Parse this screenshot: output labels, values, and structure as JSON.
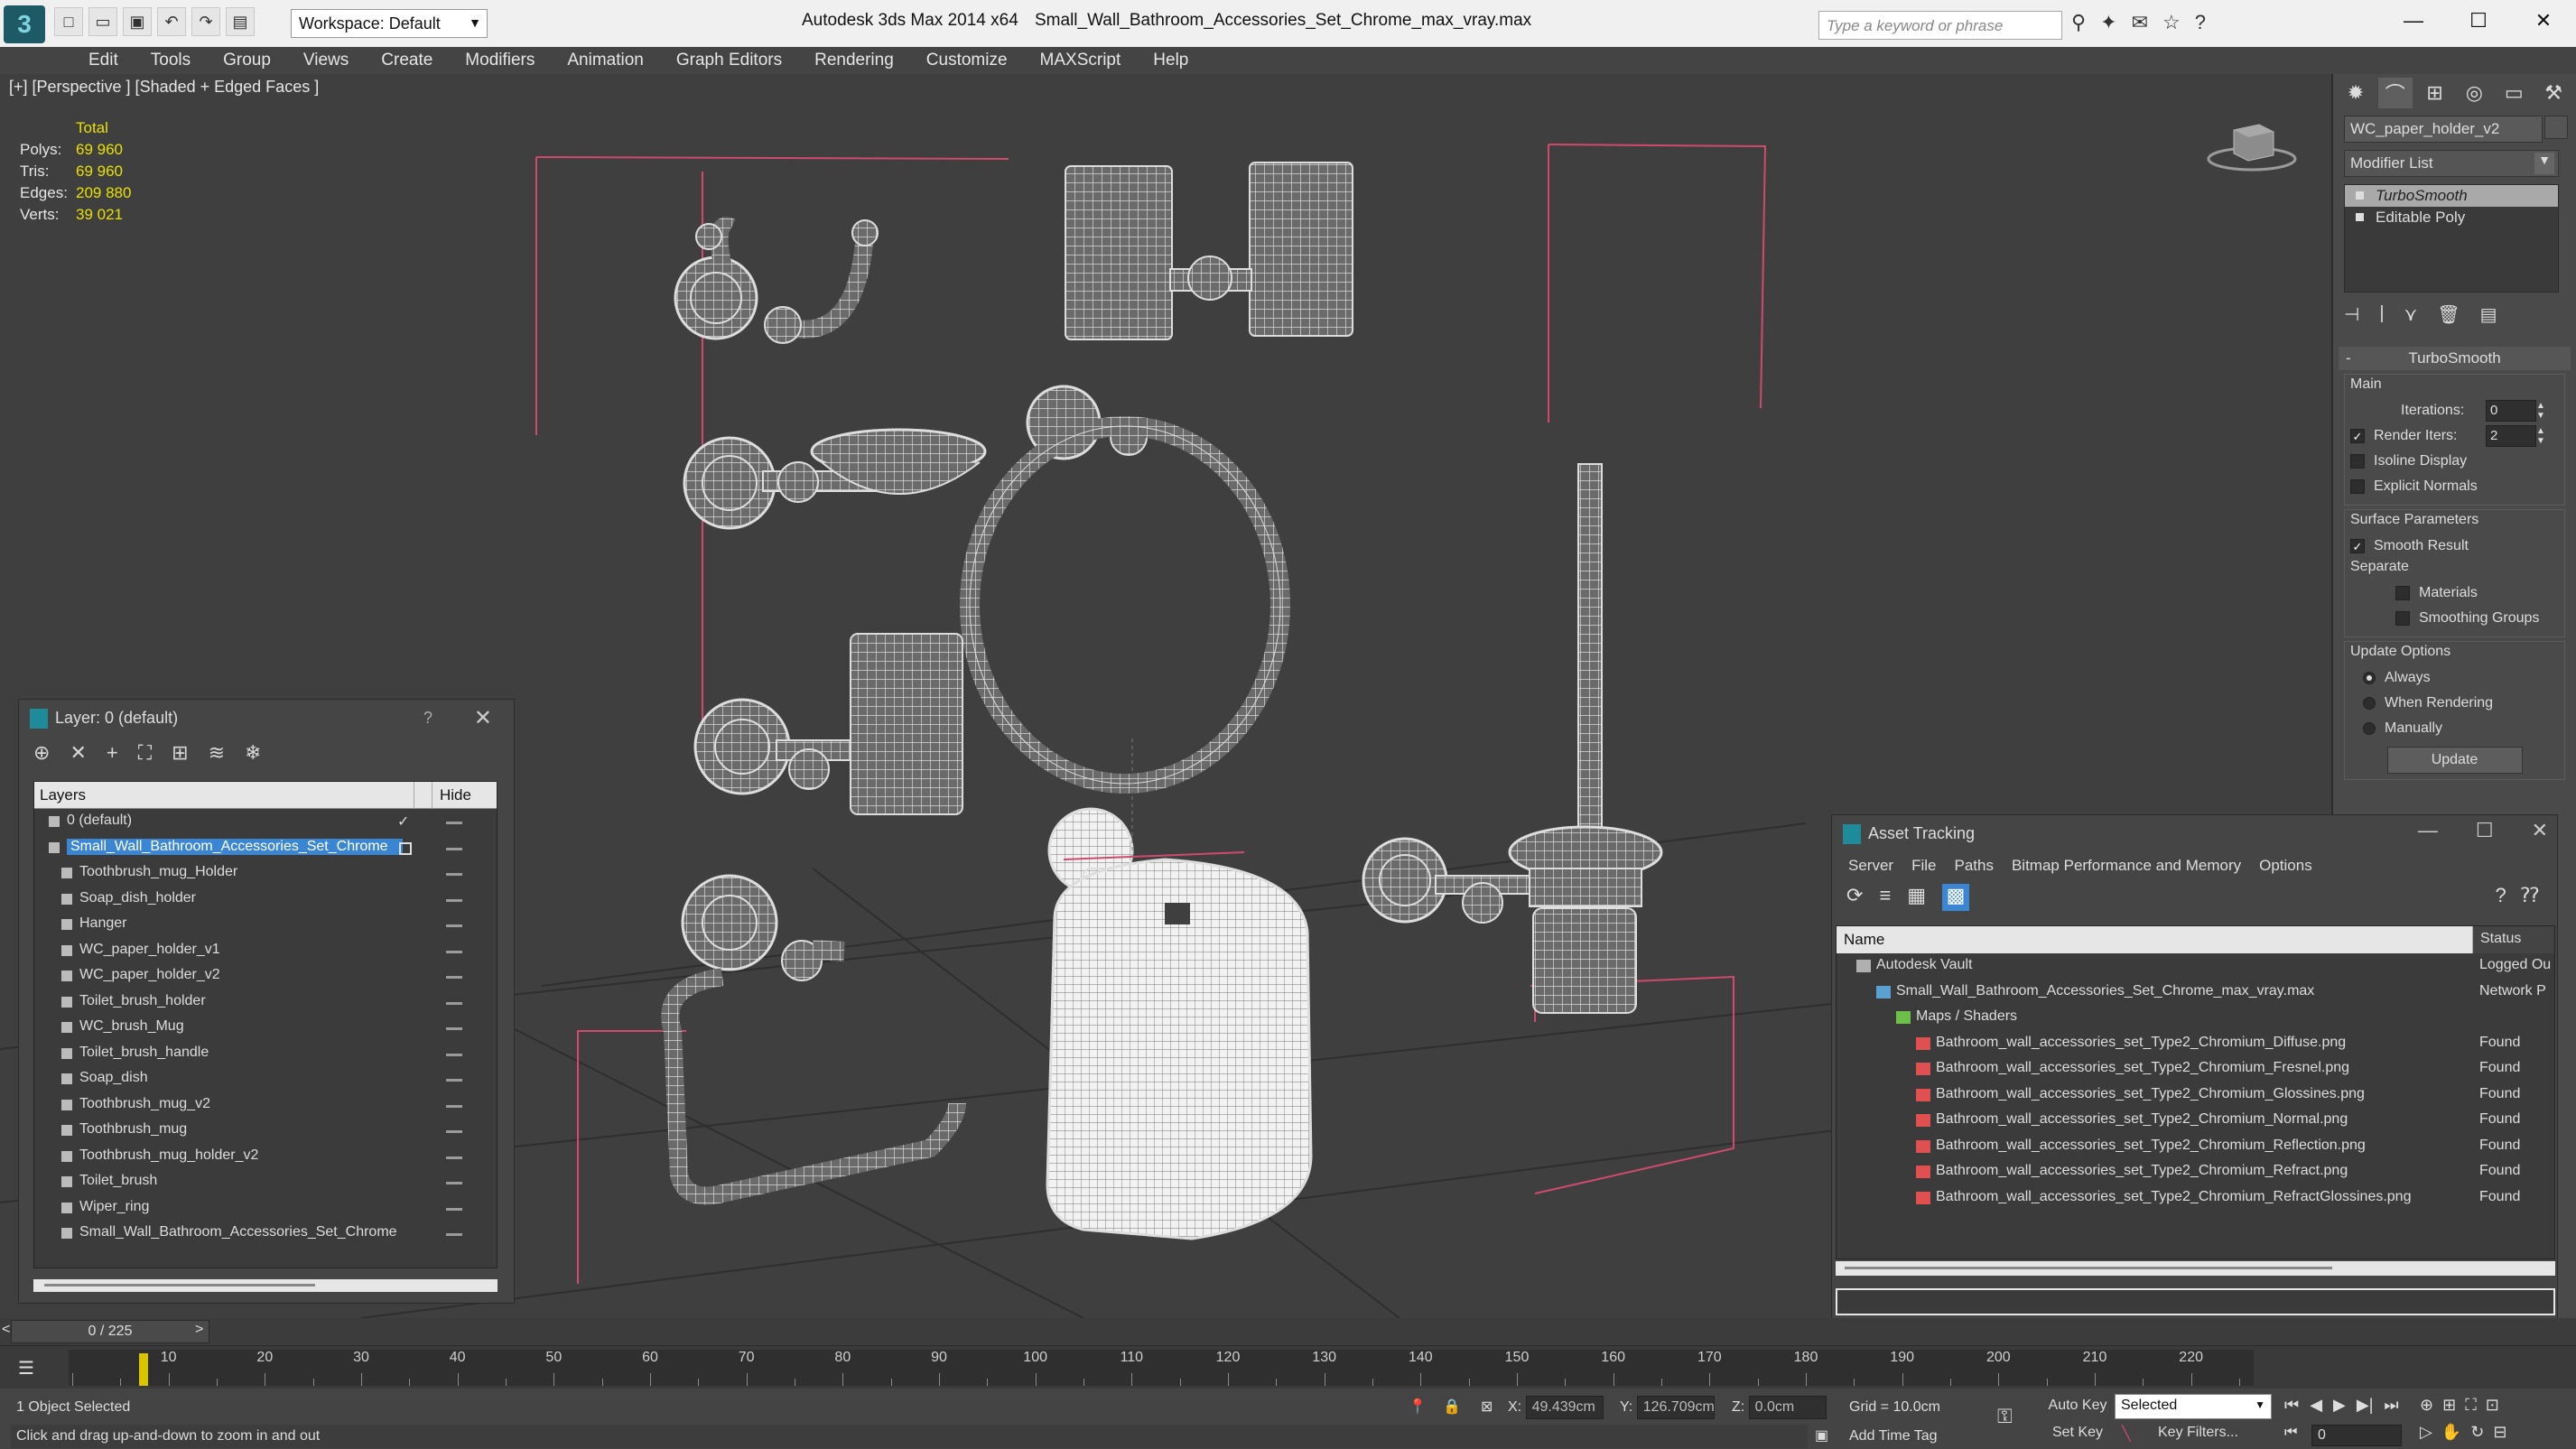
{
  "title_bar": {
    "app_title": "Autodesk 3ds Max  2014 x64",
    "file_name": "Small_Wall_Bathroom_Accessories_Set_Chrome_max_vray.max",
    "workspace": "Workspace: Default",
    "search_placeholder": "Type a keyword or phrase"
  },
  "menu": [
    "Edit",
    "Tools",
    "Group",
    "Views",
    "Create",
    "Modifiers",
    "Animation",
    "Graph Editors",
    "Rendering",
    "Customize",
    "MAXScript",
    "Help"
  ],
  "viewport": {
    "label": "[+] [Perspective ] [Shaded + Edged Faces ]",
    "stats": {
      "total_label": "Total",
      "rows": [
        {
          "label": "Polys:",
          "value": "69 960"
        },
        {
          "label": "Tris:",
          "value": "69 960"
        },
        {
          "label": "Edges:",
          "value": "209 880"
        },
        {
          "label": "Verts:",
          "value": "39 021"
        }
      ]
    }
  },
  "command_panel": {
    "object_name": "WC_paper_holder_v2",
    "modifier_list": "Modifier List",
    "stack": [
      "TurboSmooth",
      "Editable Poly"
    ],
    "rollout": "TurboSmooth",
    "main_label": "Main",
    "iterations_label": "Iterations:",
    "iterations_value": "0",
    "render_iters_label": "Render Iters:",
    "render_iters_value": "2",
    "isoline": "Isoline Display",
    "explicit_normals": "Explicit Normals",
    "surface_params": "Surface Parameters",
    "smooth_result": "Smooth Result",
    "separate": "Separate",
    "materials": "Materials",
    "smoothing_groups": "Smoothing Groups",
    "update_options": "Update Options",
    "always": "Always",
    "when_rendering": "When Rendering",
    "manually": "Manually",
    "update_btn": "Update"
  },
  "layer_dialog": {
    "title": "Layer: 0 (default)",
    "help": "?",
    "col_layers": "Layers",
    "col_hide": "Hide",
    "rows": [
      {
        "name": "0 (default)",
        "level": 0
      },
      {
        "name": "Small_Wall_Bathroom_Accessories_Set_Chrome",
        "level": 0
      },
      {
        "name": "Toothbrush_mug_Holder",
        "level": 1
      },
      {
        "name": "Soap_dish_holder",
        "level": 1
      },
      {
        "name": "Hanger",
        "level": 1
      },
      {
        "name": "WC_paper_holder_v1",
        "level": 1
      },
      {
        "name": "WC_paper_holder_v2",
        "level": 1
      },
      {
        "name": "Toilet_brush_holder",
        "level": 1
      },
      {
        "name": "WC_brush_Mug",
        "level": 1
      },
      {
        "name": "Toilet_brush_handle",
        "level": 1
      },
      {
        "name": "Soap_dish",
        "level": 1
      },
      {
        "name": "Toothbrush_mug_v2",
        "level": 1
      },
      {
        "name": "Toothbrush_mug",
        "level": 1
      },
      {
        "name": "Toothbrush_mug_holder_v2",
        "level": 1
      },
      {
        "name": "Toilet_brush",
        "level": 1
      },
      {
        "name": "Wiper_ring",
        "level": 1
      },
      {
        "name": "Small_Wall_Bathroom_Accessories_Set_Chrome",
        "level": 1
      }
    ]
  },
  "asset_dialog": {
    "title": "Asset Tracking",
    "menu": [
      "Server",
      "File",
      "Paths",
      "Bitmap Performance and Memory",
      "Options"
    ],
    "col_name": "Name",
    "col_status": "Status",
    "rows": [
      {
        "name": "Autodesk Vault",
        "status": "Logged Ou",
        "level": 0,
        "icon": "vault"
      },
      {
        "name": "Small_Wall_Bathroom_Accessories_Set_Chrome_max_vray.max",
        "status": "Network P",
        "level": 1,
        "icon": "max"
      },
      {
        "name": "Maps / Shaders",
        "status": "",
        "level": 2,
        "icon": "maps"
      },
      {
        "name": "Bathroom_wall_accessories_set_Type2_Chromium_Diffuse.png",
        "status": "Found",
        "level": 3,
        "icon": "png"
      },
      {
        "name": "Bathroom_wall_accessories_set_Type2_Chromium_Fresnel.png",
        "status": "Found",
        "level": 3,
        "icon": "png"
      },
      {
        "name": "Bathroom_wall_accessories_set_Type2_Chromium_Glossines.png",
        "status": "Found",
        "level": 3,
        "icon": "png"
      },
      {
        "name": "Bathroom_wall_accessories_set_Type2_Chromium_Normal.png",
        "status": "Found",
        "level": 3,
        "icon": "png"
      },
      {
        "name": "Bathroom_wall_accessories_set_Type2_Chromium_Reflection.png",
        "status": "Found",
        "level": 3,
        "icon": "png"
      },
      {
        "name": "Bathroom_wall_accessories_set_Type2_Chromium_Refract.png",
        "status": "Found",
        "level": 3,
        "icon": "png"
      },
      {
        "name": "Bathroom_wall_accessories_set_Type2_Chromium_RefractGlossines.png",
        "status": "Found",
        "level": 3,
        "icon": "png"
      }
    ]
  },
  "timeline": {
    "frame_display": "0 / 225",
    "ticks": [
      "10",
      "20",
      "30",
      "40",
      "50",
      "60",
      "70",
      "80",
      "90",
      "100",
      "110",
      "120",
      "130",
      "140",
      "150",
      "160",
      "170",
      "180",
      "190",
      "200",
      "210",
      "220"
    ]
  },
  "status_bar": {
    "selection": "1 Object Selected",
    "prompt": "Click and drag up-and-down to zoom in and out",
    "x_label": "X:",
    "x_value": "49.439cm",
    "y_label": "Y:",
    "y_value": "126.709cm",
    "z_label": "Z:",
    "z_value": "0.0cm",
    "grid": "Grid = 10.0cm",
    "auto_key": "Auto Key",
    "set_key": "Set Key",
    "selected_dd": "Selected",
    "key_filters": "Key Filters...",
    "add_time_tag": "Add Time Tag",
    "frame_value": "0"
  },
  "colors": {
    "stats_yellow": "#e7e000",
    "selection_blue": "#3b86d3",
    "wire_white": "#d8d8d8",
    "bbox_pink": "#d04a6e"
  }
}
